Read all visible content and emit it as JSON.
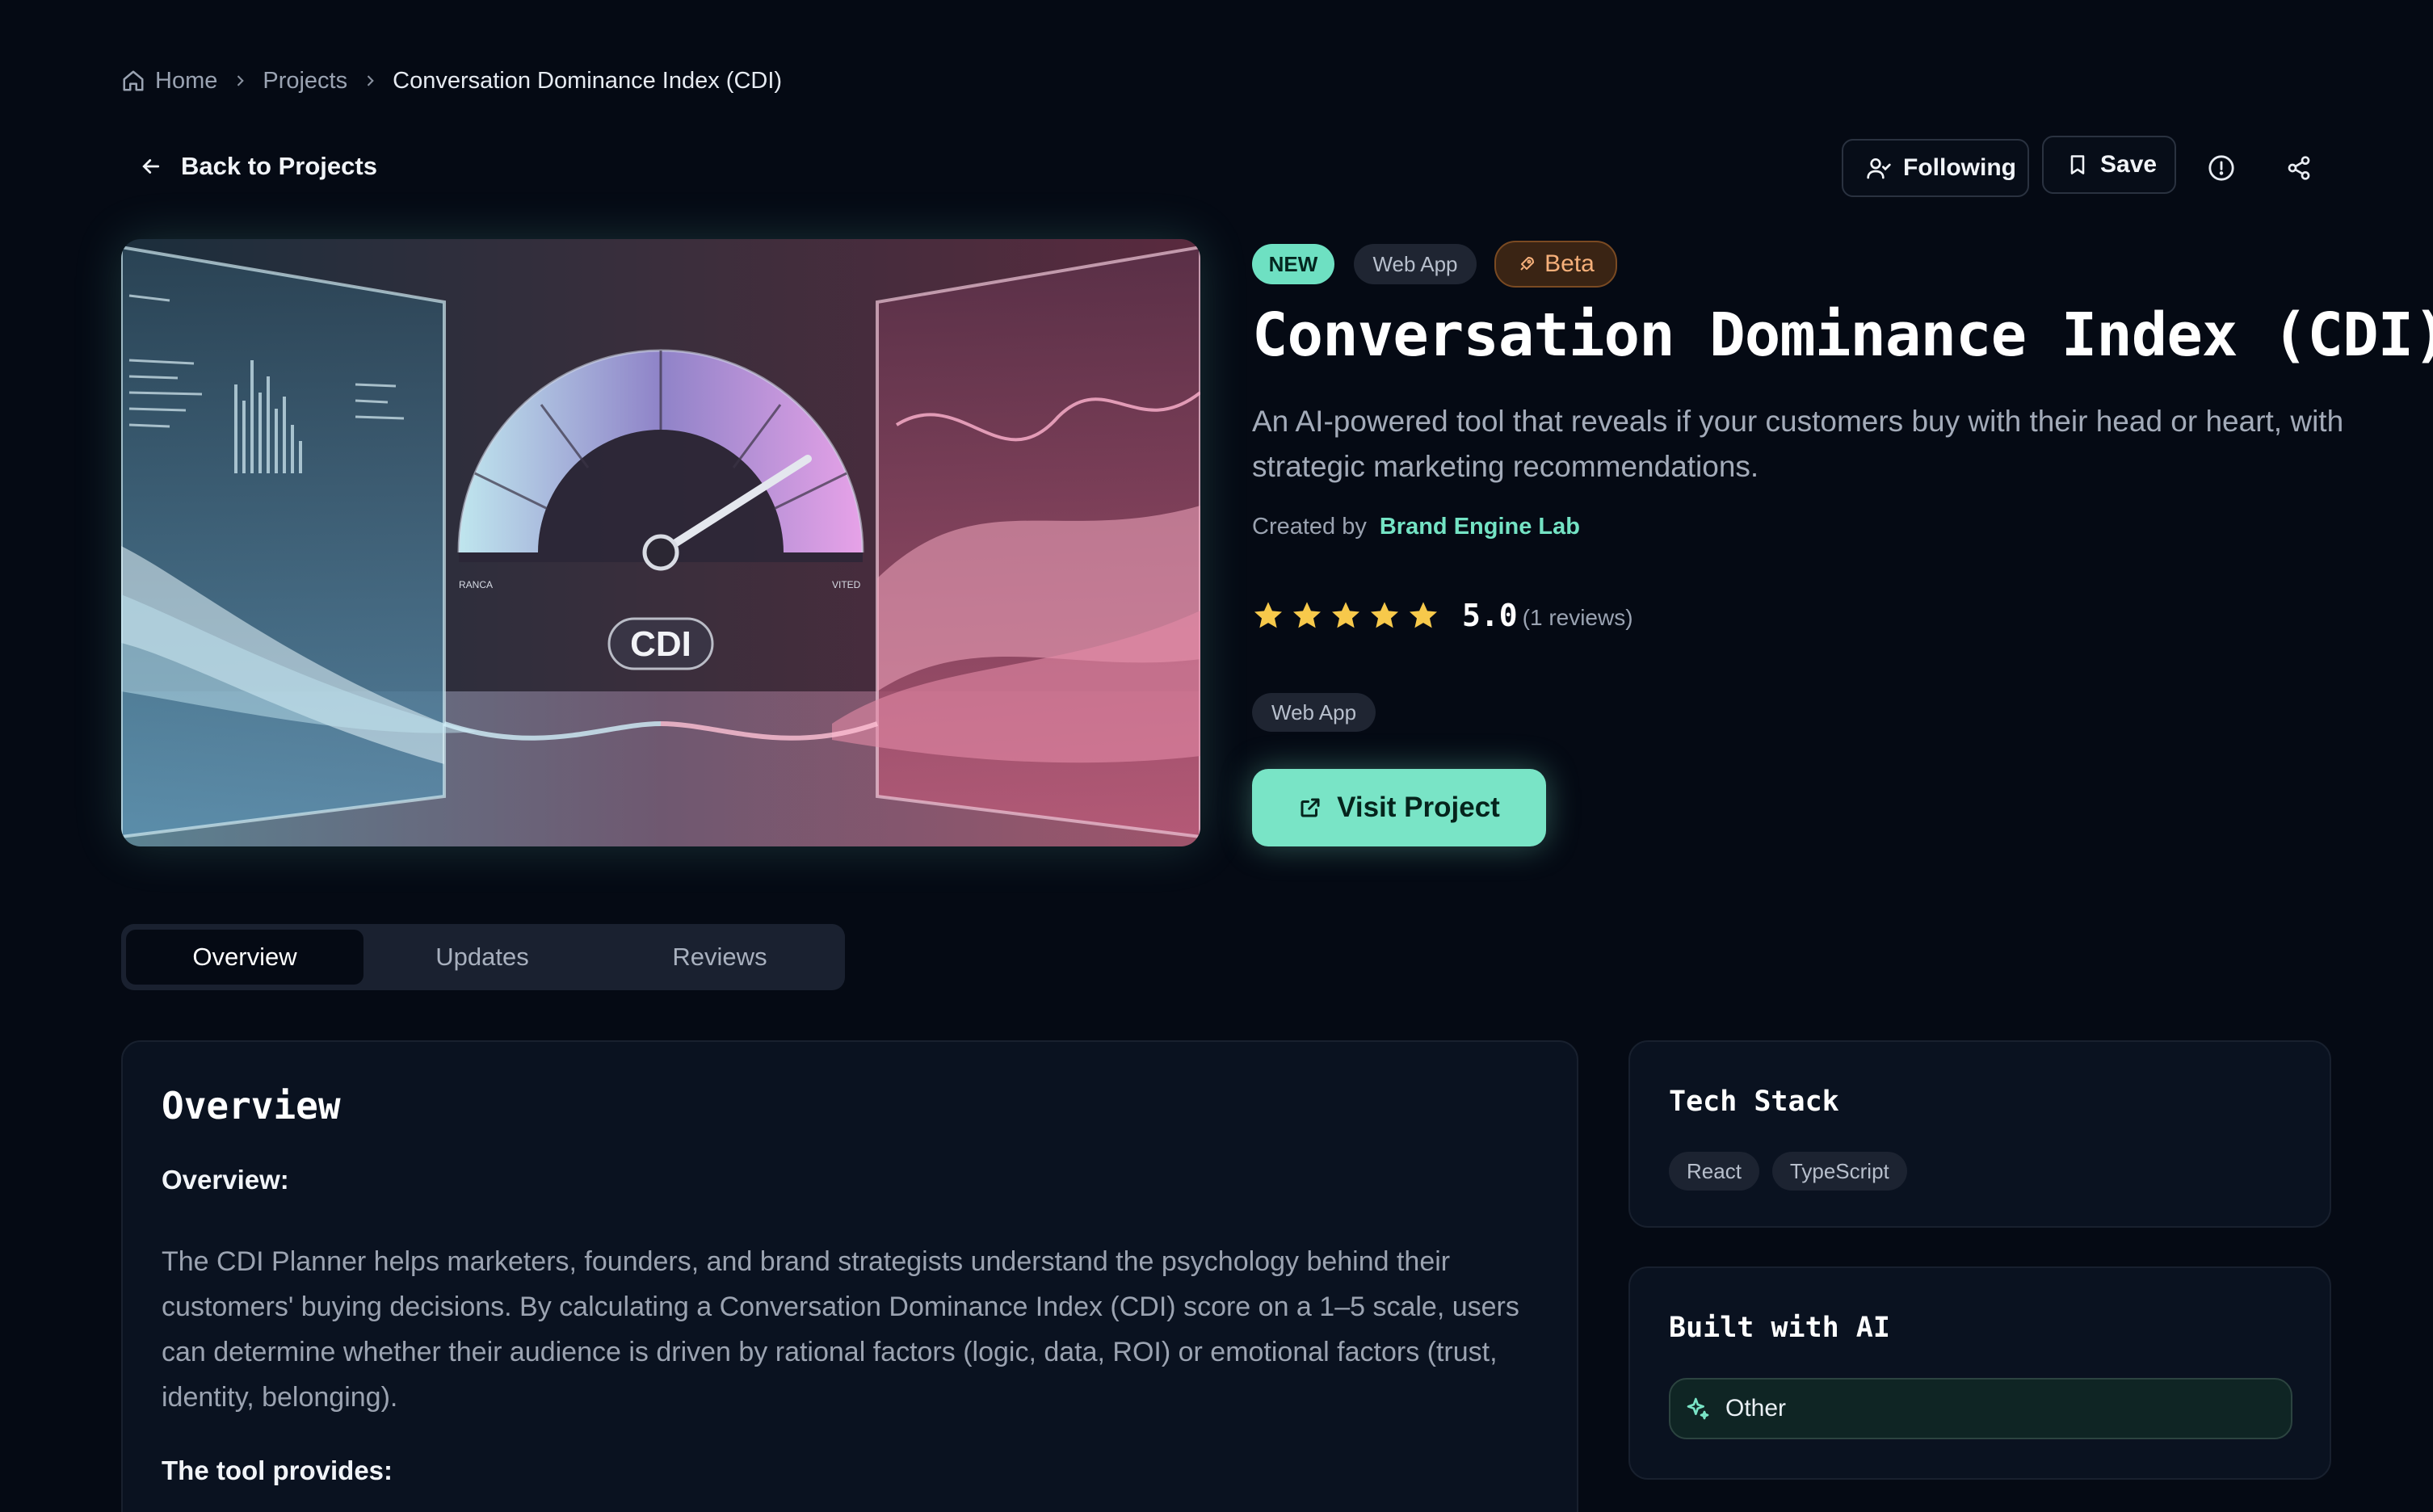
{
  "breadcrumb": {
    "home": "Home",
    "projects": "Projects",
    "current": "Conversation Dominance Index (CDI)"
  },
  "nav": {
    "back_label": "Back to Projects"
  },
  "actions": {
    "following_label": "Following",
    "save_label": "Save",
    "info_icon": "info-icon",
    "share_icon": "share-icon"
  },
  "hero": {
    "image_label": "CDI",
    "dial_left": "RANCA",
    "dial_right": "VITED"
  },
  "project": {
    "badges": {
      "new": "NEW",
      "category": "Web App",
      "stage": "Beta"
    },
    "title": "Conversation Dominance Index (CDI)",
    "description": "An AI-powered tool that reveals if your customers buy with their head or heart, with strategic marketing recommendations.",
    "created_by_label": "Created by",
    "author": "Brand Engine Lab",
    "rating": {
      "stars": 5,
      "score": "5.0",
      "reviews": "(1 reviews)"
    },
    "tag": "Web App",
    "visit_label": "Visit Project"
  },
  "tabs": [
    {
      "label": "Overview",
      "active": true
    },
    {
      "label": "Updates",
      "active": false
    },
    {
      "label": "Reviews",
      "active": false
    }
  ],
  "overview": {
    "heading": "Overview",
    "subheading": "Overview:",
    "body": "The CDI Planner helps marketers, founders, and brand strategists understand the psychology behind their customers' buying decisions. By calculating a Conversation Dominance Index (CDI) score on a 1–5 scale, users can determine whether their audience is driven by rational factors (logic, data, ROI) or emotional factors (trust, identity, belonging).",
    "subheading2": "The tool provides:"
  },
  "tech_stack": {
    "heading": "Tech Stack",
    "items": [
      "React",
      "TypeScript"
    ]
  },
  "built_with_ai": {
    "heading": "Built with AI",
    "value": "Other"
  },
  "colors": {
    "background": "#050a14",
    "accent": "#79e4c6",
    "beta": "#f6b07a",
    "star": "#f7c94b"
  }
}
